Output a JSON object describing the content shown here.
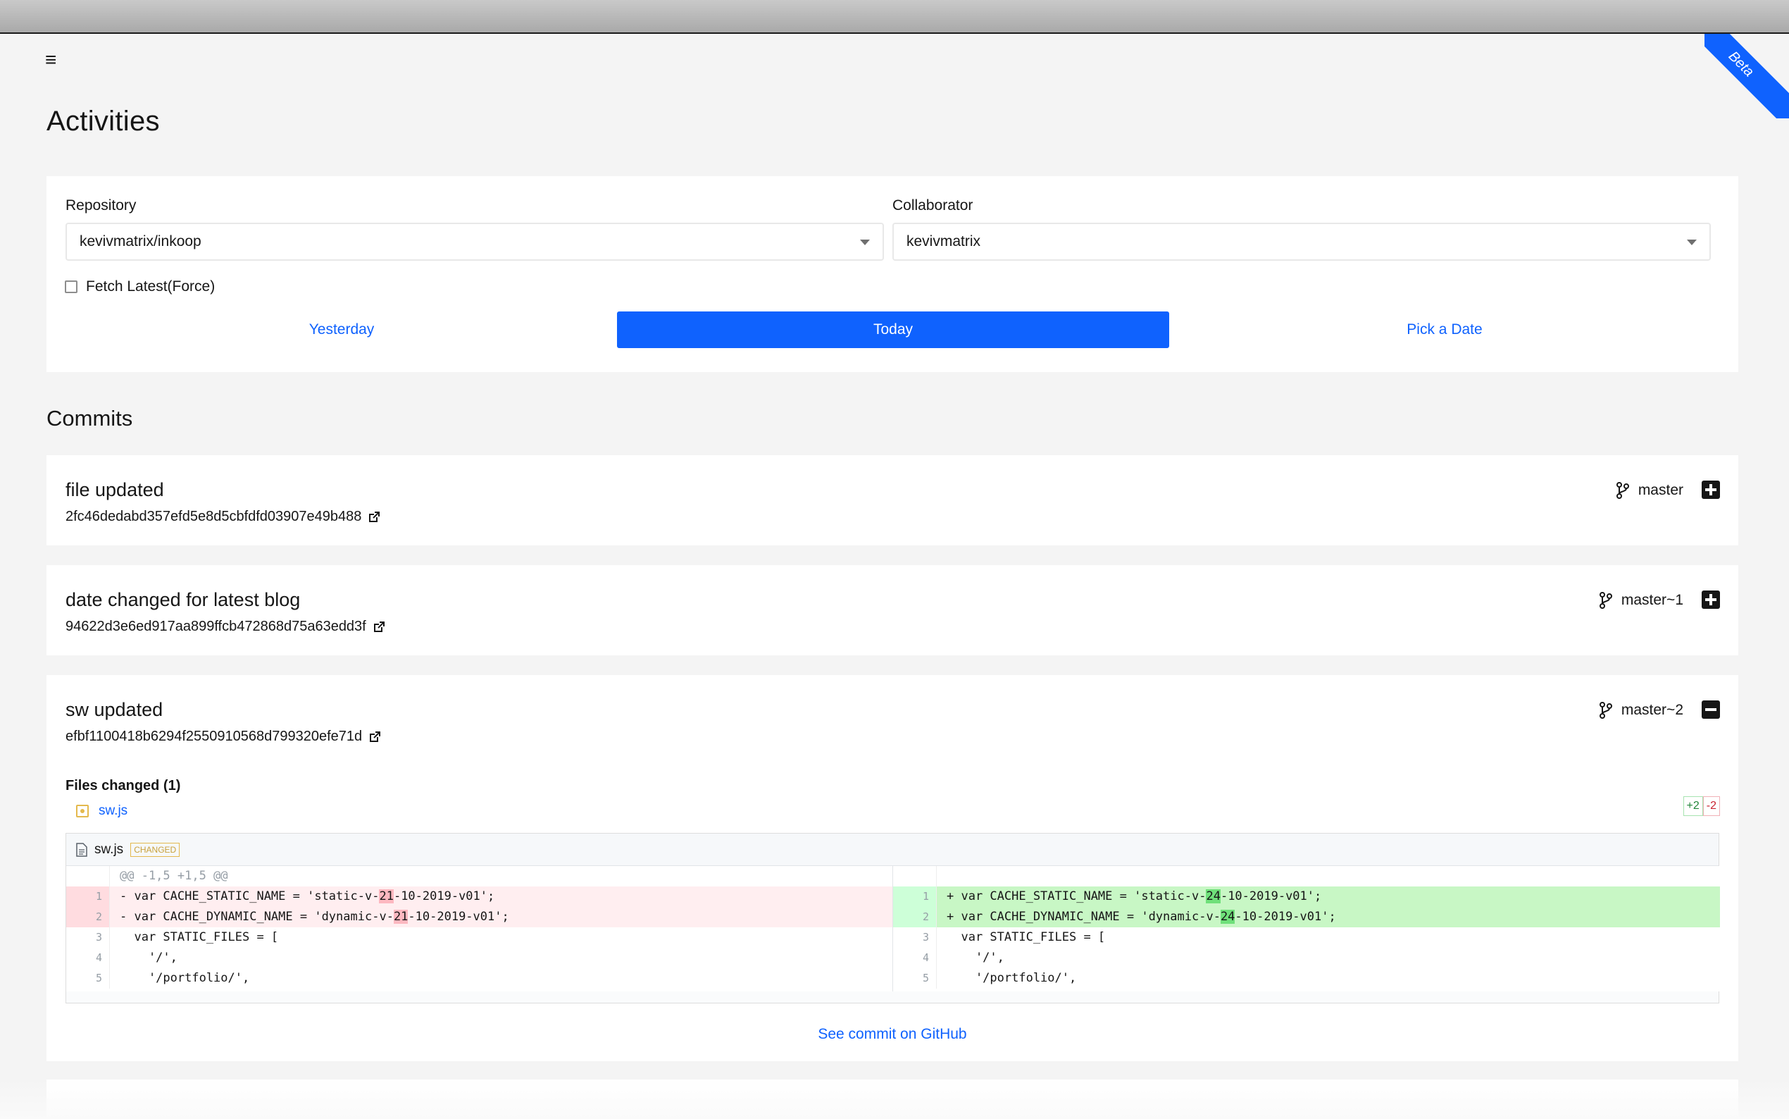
{
  "page": {
    "title": "Activities",
    "beta_label": "Beta"
  },
  "filters": {
    "repository_label": "Repository",
    "repository_value": "kevivmatrix/inkoop",
    "collaborator_label": "Collaborator",
    "collaborator_value": "kevivmatrix",
    "fetch_latest_label": "Fetch Latest(Force)",
    "date_buttons": [
      "Yesterday",
      "Today",
      "Pick a Date"
    ],
    "active_date": "Today"
  },
  "commits_title": "Commits",
  "commits": [
    {
      "message": "file updated",
      "sha": "2fc46dedabd357efd5e8d5cbfdfd03907e49b488",
      "branch": "master",
      "expanded": false
    },
    {
      "message": "date changed for latest blog",
      "sha": "94622d3e6ed917aa899ffcb472868d75a63edd3f",
      "branch": "master~1",
      "expanded": false
    },
    {
      "message": "sw updated",
      "sha": "efbf1100418b6294f2550910568d799320efe71d",
      "branch": "master~2",
      "expanded": true
    }
  ],
  "expanded_commit": {
    "files_changed_label": "Files changed (1)",
    "file_name": "sw.js",
    "additions": "+2",
    "deletions": "-2",
    "changed_badge": "CHANGED",
    "hunk_header": "@@ -1,5 +1,5 @@",
    "left_lines": [
      {
        "n": "1",
        "type": "del",
        "pre": "- var CACHE_STATIC_NAME = 'static-v-",
        "hl": "21",
        "post": "-10-2019-v01';"
      },
      {
        "n": "2",
        "type": "del",
        "pre": "- var CACHE_DYNAMIC_NAME = 'dynamic-v-",
        "hl": "21",
        "post": "-10-2019-v01';"
      },
      {
        "n": "3",
        "type": "ctx",
        "pre": "  var STATIC_FILES = [",
        "hl": "",
        "post": ""
      },
      {
        "n": "4",
        "type": "ctx",
        "pre": "    '/',",
        "hl": "",
        "post": ""
      },
      {
        "n": "5",
        "type": "ctx",
        "pre": "    '/portfolio/',",
        "hl": "",
        "post": ""
      }
    ],
    "right_lines": [
      {
        "n": "1",
        "type": "add",
        "pre": "+ var CACHE_STATIC_NAME = 'static-v-",
        "hl": "24",
        "post": "-10-2019-v01';"
      },
      {
        "n": "2",
        "type": "add",
        "pre": "+ var CACHE_DYNAMIC_NAME = 'dynamic-v-",
        "hl": "24",
        "post": "-10-2019-v01';"
      },
      {
        "n": "3",
        "type": "ctx",
        "pre": "  var STATIC_FILES = [",
        "hl": "",
        "post": ""
      },
      {
        "n": "4",
        "type": "ctx",
        "pre": "    '/',",
        "hl": "",
        "post": ""
      },
      {
        "n": "5",
        "type": "ctx",
        "pre": "    '/portfolio/',",
        "hl": "",
        "post": ""
      }
    ],
    "see_github_label": "See commit on GitHub"
  },
  "colors": {
    "accent": "#0f62fe",
    "deleted": "#ffeef0",
    "added": "#c8f7c5"
  },
  "icons": {
    "menu": "hamburger-icon",
    "branch": "git-branch-icon",
    "external": "external-link-icon",
    "expand": "plus-square-icon",
    "collapse": "minus-square-icon",
    "file": "file-icon"
  }
}
